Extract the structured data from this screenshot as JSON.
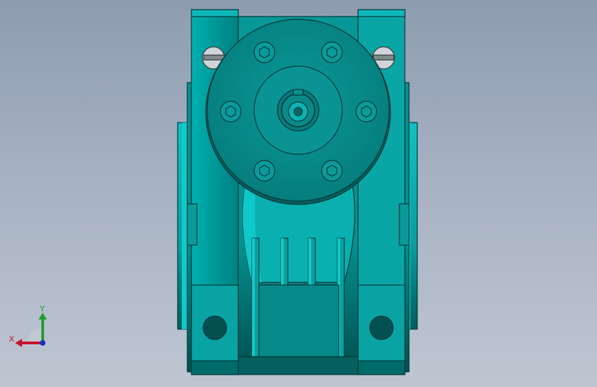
{
  "view": {
    "colors": {
      "body": "#008c8c",
      "body_light": "#10c8c8",
      "body_dark": "#005a5a",
      "edge": "#003c3c",
      "hole": "#025252",
      "bolt_ring": "#d0d3d8"
    }
  },
  "triad": {
    "x_label": "X",
    "y_label": "Y",
    "x_color": "#c8102e",
    "y_color": "#1f9d2e",
    "z_color": "#1530c8"
  }
}
